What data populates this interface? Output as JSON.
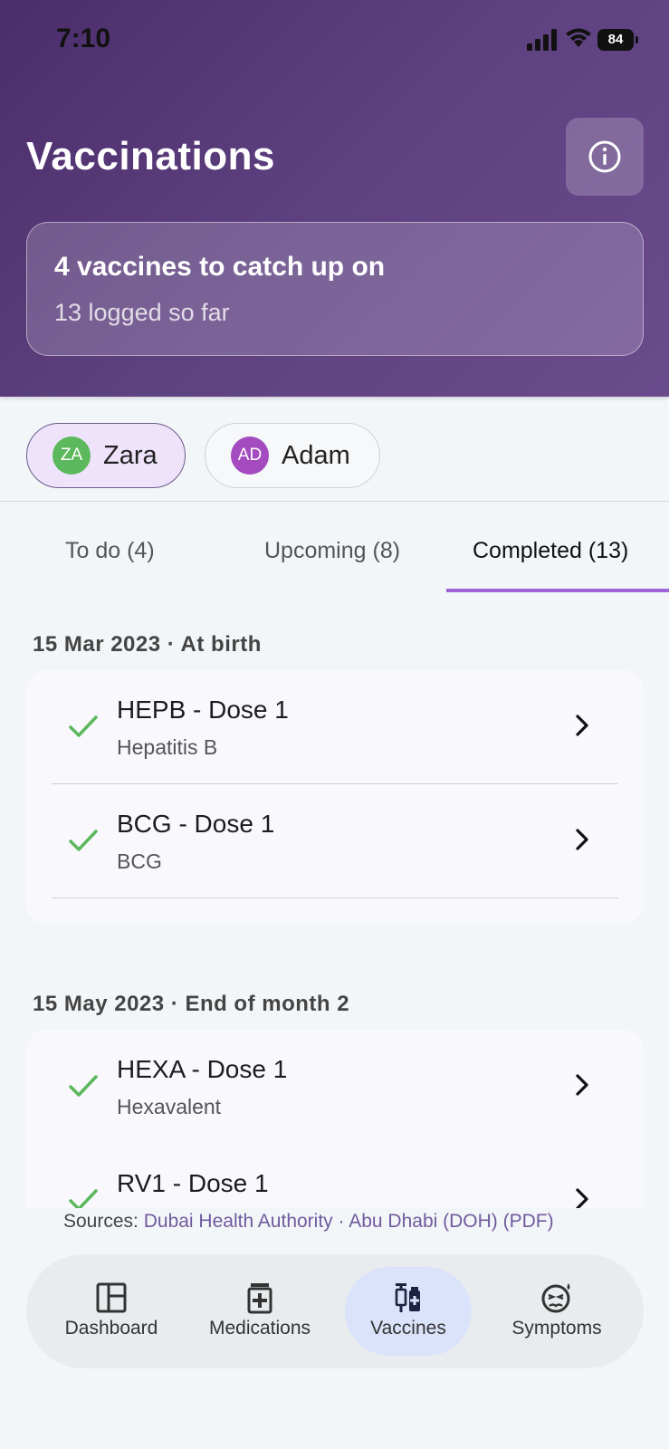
{
  "status_bar": {
    "time": "7:10",
    "battery": "84"
  },
  "header": {
    "title": "Vaccinations",
    "summary_title": "4 vaccines to catch up on",
    "summary_sub": "13 logged so far"
  },
  "profiles": [
    {
      "initials": "ZA",
      "name": "Zara",
      "selected": true,
      "color": "#5cb85c"
    },
    {
      "initials": "AD",
      "name": "Adam",
      "selected": false,
      "color": "#a34bbf"
    }
  ],
  "tabs": [
    {
      "label": "To do (4)"
    },
    {
      "label": "Upcoming (8)"
    },
    {
      "label": "Completed (13)",
      "active": true
    }
  ],
  "groups": [
    {
      "title": "15 Mar 2023 · At birth",
      "items": [
        {
          "title": "HEPB - Dose 1",
          "subtitle": "Hepatitis B"
        },
        {
          "title": "BCG - Dose 1",
          "subtitle": "BCG"
        }
      ]
    },
    {
      "title": "15 May 2023 · End of month 2",
      "items": [
        {
          "title": "HEXA - Dose 1",
          "subtitle": "Hexavalent"
        },
        {
          "title": "RV1 - Dose 1",
          "subtitle": ""
        }
      ]
    }
  ],
  "sources": {
    "prefix": "Sources:",
    "link1": "Dubai Health Authority",
    "sep": "·",
    "link2": "Abu Dhabi (DOH) (PDF)"
  },
  "nav": [
    {
      "label": "Dashboard",
      "icon": "dashboard-icon"
    },
    {
      "label": "Medications",
      "icon": "medications-icon"
    },
    {
      "label": "Vaccines",
      "icon": "vaccines-icon",
      "active": true
    },
    {
      "label": "Symptoms",
      "icon": "symptoms-icon"
    }
  ],
  "colors": {
    "header_gradient_start": "#4c2d6b",
    "header_gradient_end": "#6a4b8c",
    "accent": "#9c64d8",
    "check": "#5cb85c",
    "active_nav": "#dbe3fb"
  }
}
